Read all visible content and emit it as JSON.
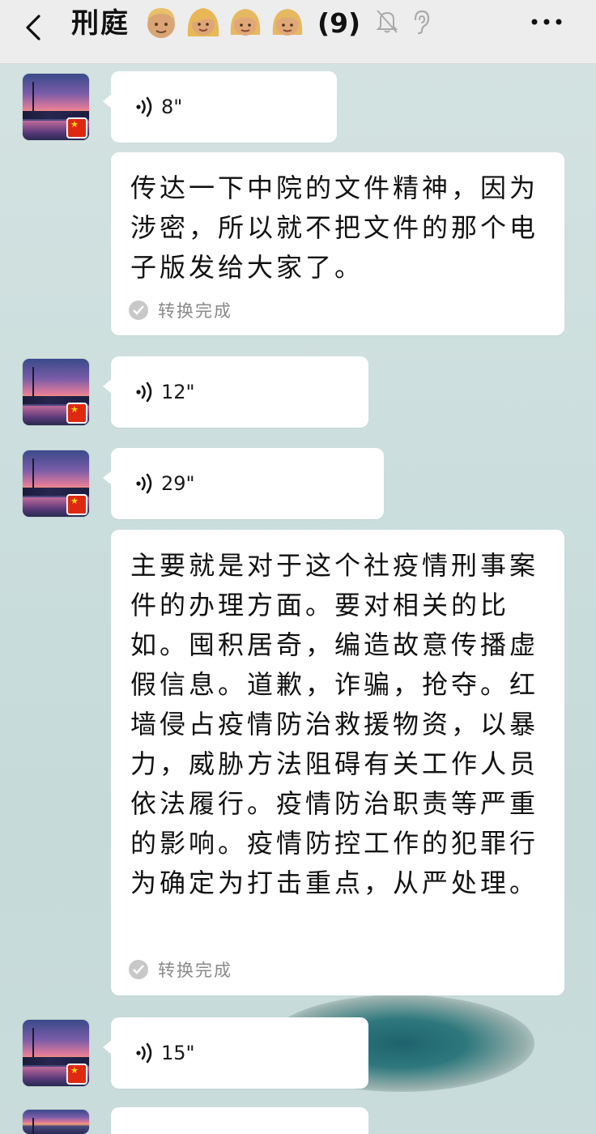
{
  "header": {
    "title": "刑庭",
    "emojis": [
      "man-blond-icon",
      "woman-blond-icon",
      "girl-blond-icon",
      "girl-blond-icon"
    ],
    "member_count": "(9)",
    "icons": [
      "back-icon",
      "mute-icon",
      "ear-icon",
      "more-icon"
    ]
  },
  "messages": [
    {
      "type": "voice",
      "duration": "8\""
    },
    {
      "type": "transcript",
      "text": "传达一下中院的文件精神，因为涉密，所以就不把文件的那个电子版发给大家了。",
      "status": "转换完成"
    },
    {
      "type": "voice",
      "duration": "12\""
    },
    {
      "type": "voice",
      "duration": "29\""
    },
    {
      "type": "transcript",
      "text": "主要就是对于这个社疫情刑事案件的办理方面。要对相关的比如。囤积居奇，编造故意传播虚假信息。道歉，诈骗，抢夺。红墙侵占疫情防治救援物资，以暴力，威胁方法阻碍有关工作人员依法履行。疫情防治职责等严重的影响。疫情防控工作的犯罪行为确定为打击重点，从严处理。",
      "status": "转换完成"
    },
    {
      "type": "voice",
      "duration": "15\""
    }
  ],
  "colors": {
    "topbar": "#ededed",
    "chat_background": "#cfe0df",
    "bubble": "#ffffff",
    "flag_red": "#de2910"
  }
}
